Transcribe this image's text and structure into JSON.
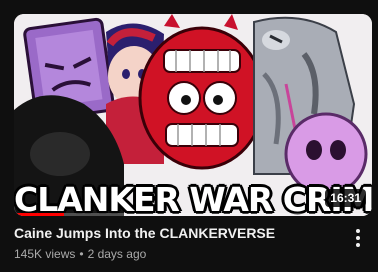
{
  "video": {
    "thumbnail_text": "CLANKER WAR CRIMES",
    "duration": "16:31",
    "watch_progress": 0.14,
    "title": "Caine Jumps Into the CLANKERVERSE",
    "views": "145K views",
    "separator": "•",
    "published": "2 days ago"
  },
  "icons": {
    "menu": "more-vertical-icon"
  },
  "colors": {
    "background": "#0f0f0f",
    "title": "#f1f1f1",
    "meta": "#aaaaaa",
    "progress": "#ff0000"
  }
}
